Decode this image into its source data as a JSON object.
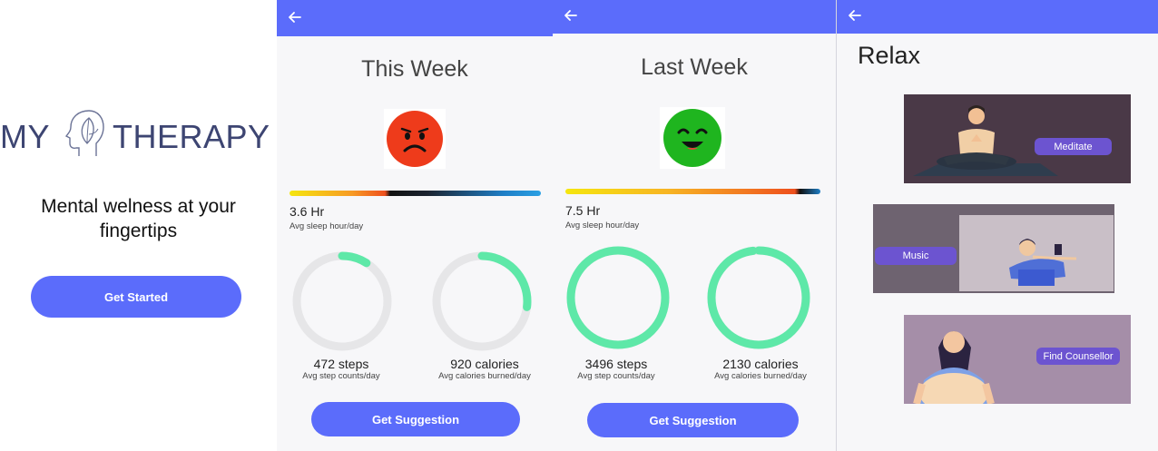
{
  "welcome": {
    "logo_left": "MY",
    "logo_right": "THERAPY",
    "tagline": "Mental welness at your fingertips",
    "button_label": "Get Started"
  },
  "this_week": {
    "title": "This Week",
    "mood": "sad",
    "mood_color": "#ee3b1b",
    "sleep_value": "3.6 Hr",
    "sleep_label": "Avg sleep hour/day",
    "steps_value": "472 steps",
    "steps_label": "Avg step counts/day",
    "steps_progress": 0.09,
    "calories_value": "920 calories",
    "calories_label": "Avg calories burned/day",
    "calories_progress": 0.27,
    "button_label": "Get Suggestion"
  },
  "last_week": {
    "title": "Last Week",
    "mood": "happy",
    "mood_color": "#1fb51f",
    "sleep_value": "7.5 Hr",
    "sleep_label": "Avg sleep hour/day",
    "steps_value": "3496 steps",
    "steps_label": "Avg step counts/day",
    "steps_progress": 1.0,
    "calories_value": "2130 calories",
    "calories_label": "Avg calories burned/day",
    "calories_progress": 0.98,
    "button_label": "Get Suggestion"
  },
  "relax": {
    "title": "Relax",
    "cards": [
      {
        "label": "Meditate"
      },
      {
        "label": "Music"
      },
      {
        "label": "Find Counsellor"
      }
    ]
  },
  "colors": {
    "accent": "#5b6cfb",
    "ring_track": "#e6e6e8",
    "ring_fill": "#5ee8a8",
    "card_button": "#6c54d0"
  },
  "icons": {
    "back": "arrow-left-icon"
  }
}
